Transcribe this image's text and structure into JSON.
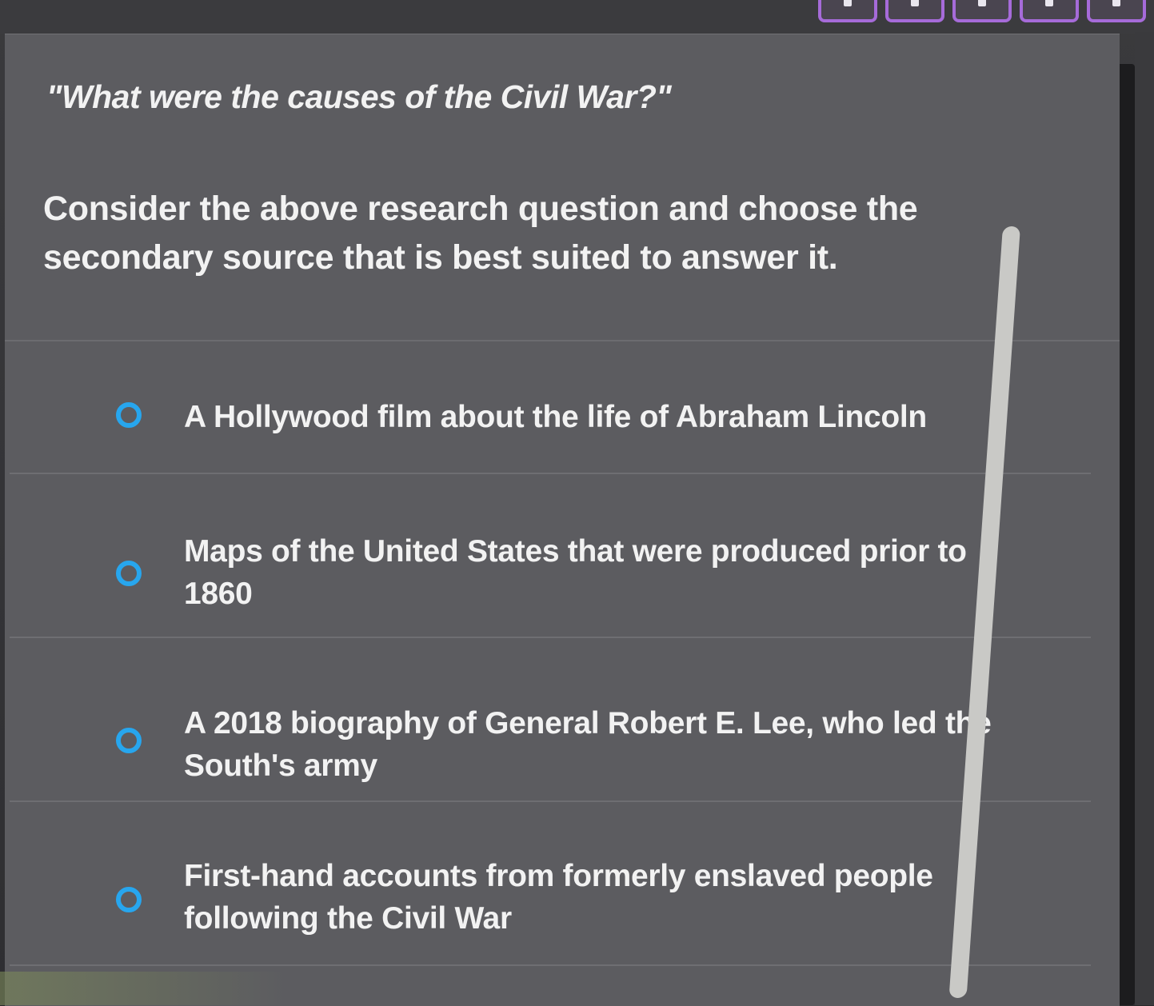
{
  "question": {
    "title": "\"What were the causes of the Civil War?\"",
    "prompt": "Consider the above research question and choose the secondary source that is best suited to answer it."
  },
  "choices": [
    {
      "label": "A Hollywood film about the life of Abraham Lincoln",
      "selected": false
    },
    {
      "label": "Maps of the United States that were produced prior to 1860",
      "selected": false
    },
    {
      "label": "A 2018 biography of General Robert E. Lee, who led the South's army",
      "selected": false
    },
    {
      "label": "First-hand accounts from formerly enslaved people following the Civil War",
      "selected": false
    }
  ],
  "colors": {
    "radio_accent": "#27a6ee",
    "nav_accent": "#a66bd9",
    "card_background": "#5c5c60",
    "text": "#f2f2f2"
  },
  "icons": {
    "radio": "radio-unselected-icon",
    "nav": "question-nav-square"
  }
}
